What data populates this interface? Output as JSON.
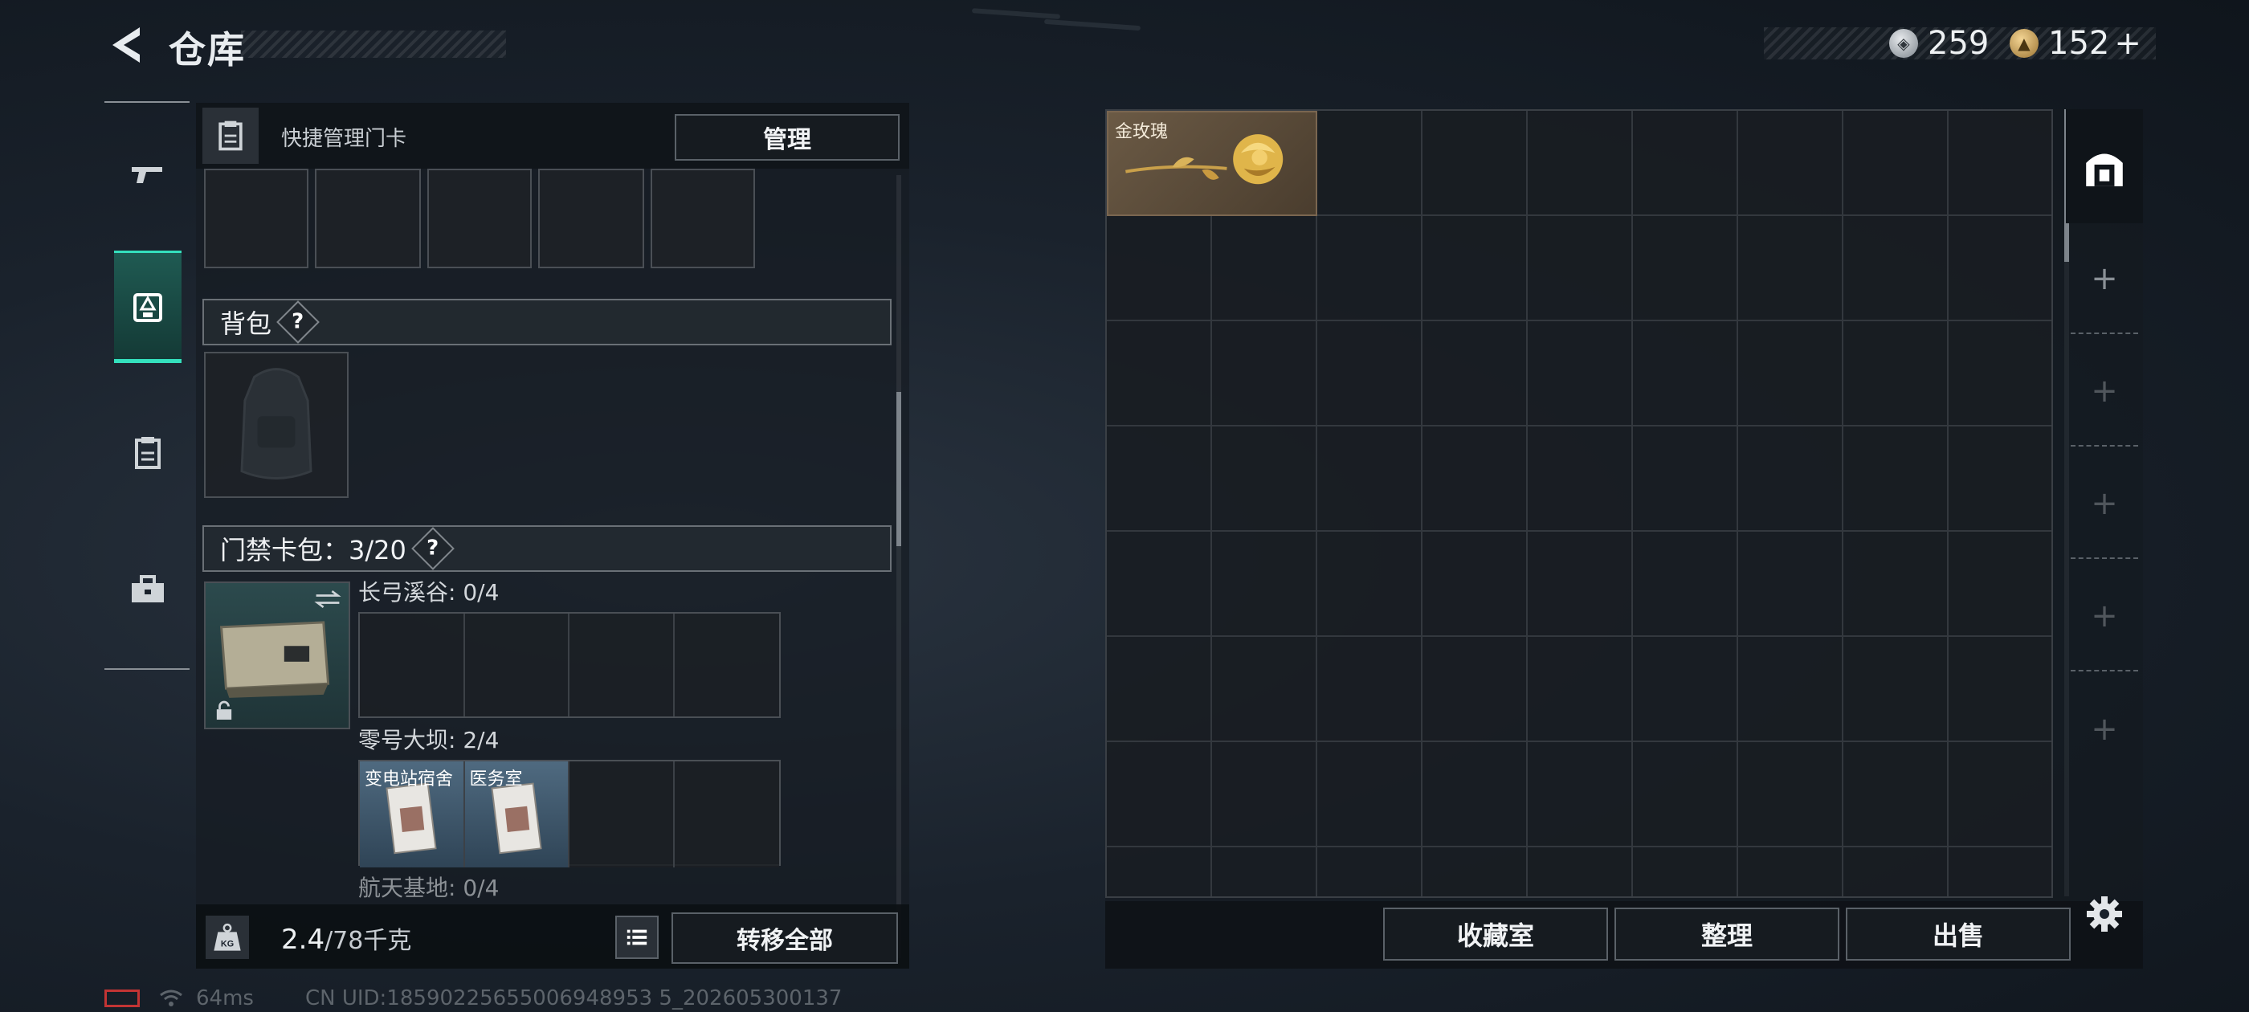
{
  "header": {
    "title": "仓库",
    "currency": [
      {
        "icon": "silver-coin-icon",
        "value": "259"
      },
      {
        "icon": "gold-coin-icon",
        "value": "152"
      }
    ],
    "add_symbol": "+"
  },
  "left_rail": {
    "tabs": [
      {
        "name": "weapon",
        "icon": "gun-icon",
        "active": false
      },
      {
        "name": "equipment",
        "icon": "backpack-gear-icon",
        "active": true
      },
      {
        "name": "keycard",
        "icon": "clipboard-icon",
        "active": false
      },
      {
        "name": "toolbox",
        "icon": "toolbox-icon",
        "active": false
      }
    ]
  },
  "left_panel": {
    "quick_manage_label": "快捷管理门卡",
    "manage_button": "管理",
    "backpack_section": {
      "title": "背包",
      "help": "?"
    },
    "keycard_pack_section": {
      "title": "门禁卡包：3/20",
      "help": "?"
    },
    "keycard_groups": [
      {
        "title": "长弓溪谷: 0/4",
        "cards": []
      },
      {
        "title": "零号大坝: 2/4",
        "cards": [
          "变电站宿舍",
          "医务室"
        ]
      },
      {
        "title": "航天基地: 0/4",
        "cards": []
      }
    ],
    "footer": {
      "weight": "2.4",
      "weight_cap": "/78千克",
      "kg_label": "KG",
      "transfer_button": "转移全部"
    }
  },
  "storage": {
    "items": [
      {
        "name": "金玫瑰",
        "icon": "golden-rose-icon"
      }
    ],
    "buttons": {
      "collection": "收藏室",
      "sort": "整理",
      "sell": "出售"
    },
    "side_add": "+"
  },
  "status_bar": {
    "ping": "64ms",
    "uid": "CN UID:18590225655006948953 5_202605300137"
  },
  "colors": {
    "accent": "#34e0bd",
    "card_blue": "#4f6a80",
    "rose_bg": "#6b5a45",
    "battery_red": "#c23434"
  }
}
